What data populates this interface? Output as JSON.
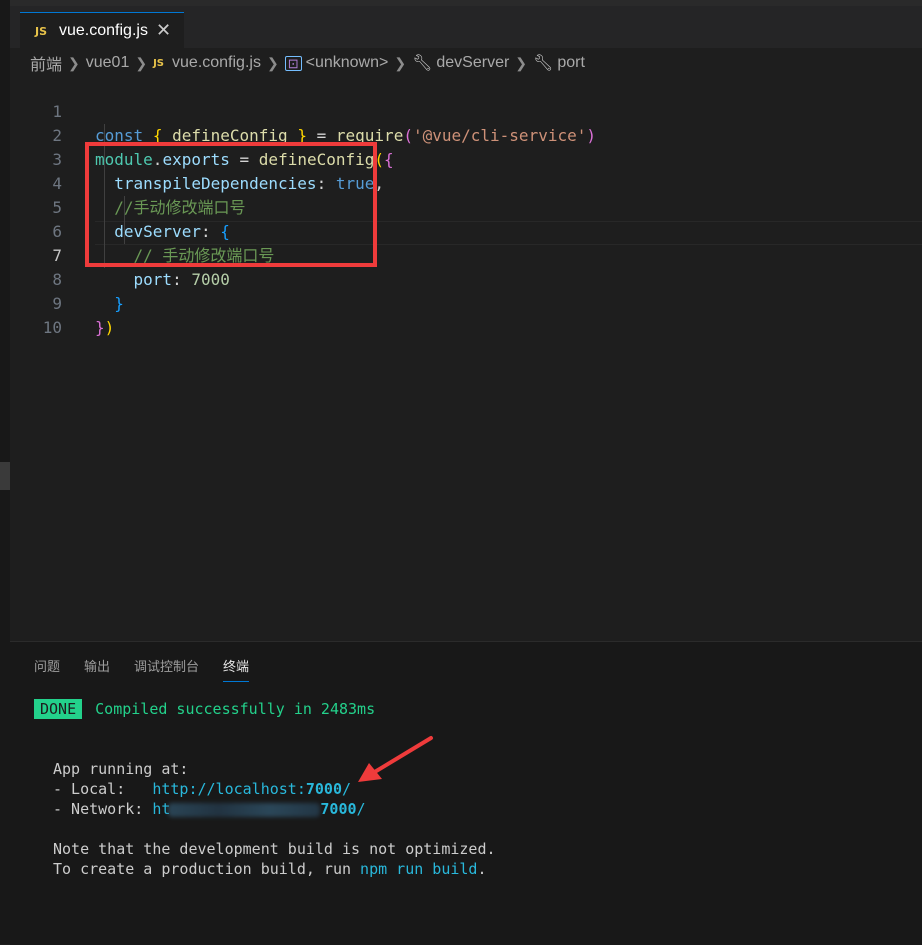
{
  "tab": {
    "icon": "JS",
    "name": "vue.config.js",
    "close": "✕"
  },
  "breadcrumb": [
    {
      "type": "folder",
      "label": "前端"
    },
    {
      "type": "folder",
      "label": "vue01"
    },
    {
      "type": "file",
      "icon": "JS",
      "label": "vue.config.js"
    },
    {
      "type": "symbol",
      "label": "<unknown>"
    },
    {
      "type": "property",
      "label": "devServer"
    },
    {
      "type": "property",
      "label": "port"
    }
  ],
  "editor": {
    "line_numbers": [
      "1",
      "2",
      "3",
      "4",
      "5",
      "6",
      "7",
      "8",
      "9",
      "10"
    ],
    "active_line": "7",
    "lines": {
      "l1": {
        "kw": "const",
        "b_open": "{",
        "name": "defineConfig",
        "b_close": "}",
        "eq": "=",
        "fn": "require",
        "p_open": "(",
        "str": "'@vue/cli-service'",
        "p_close": ")"
      },
      "l2": {
        "obj": "module",
        "dot": ".",
        "prop": "exports",
        "eq": "=",
        "fn": "defineConfig",
        "p_open": "(",
        "b_open": "{"
      },
      "l3": {
        "prop": "transpileDependencies",
        "colon": ":",
        "val": "true",
        "comma": ","
      },
      "l4": {
        "comment": "//手动修改端口号"
      },
      "l5": {
        "prop": "devServer",
        "colon": ":",
        "b_open": "{"
      },
      "l6": {
        "comment": "// 手动修改端口号"
      },
      "l7": {
        "prop": "port",
        "colon": ":",
        "val": "7000"
      },
      "l8": {
        "b_close": "}"
      },
      "l9": {
        "b_close": "}",
        "p_close": ")"
      }
    }
  },
  "panel": {
    "tabs": [
      "问题",
      "输出",
      "调试控制台",
      "终端"
    ],
    "active_tab": "终端",
    "terminal": {
      "done_badge": "DONE",
      "compiled": "Compiled successfully in 2483ms",
      "app_running": "App running at:",
      "local_label": "- Local:   ",
      "local_url": "http://localhost:",
      "local_port": "7000",
      "local_slash": "/",
      "network_label": "- Network: ",
      "network_url_start": "ht",
      "network_port": "7000",
      "network_slash": "/",
      "note": "Note that the development build is not optimized.",
      "prod_prefix": "To create a production build, run ",
      "prod_cmd": "npm run build",
      "prod_suffix": "."
    }
  },
  "colors": {
    "highlight_box": "#ef3b3b",
    "arrow": "#ef3b3b",
    "accent": "#0078d4"
  }
}
